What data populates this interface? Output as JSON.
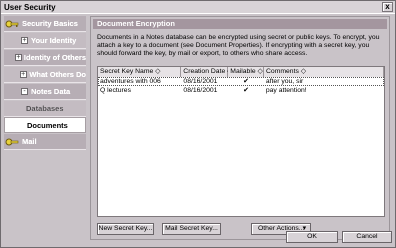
{
  "window": {
    "title": "User Security",
    "close_label": "x"
  },
  "sidebar": {
    "items": [
      {
        "label": "Security Basics",
        "icon": "security-basics-icon",
        "expander": ""
      },
      {
        "label": "Your Identity",
        "icon": "",
        "expander": "+"
      },
      {
        "label": "Identity of Others",
        "icon": "",
        "expander": "+"
      },
      {
        "label": "What Others Do",
        "icon": "",
        "expander": "+"
      },
      {
        "label": "Notes Data",
        "icon": "",
        "expander": "-"
      },
      {
        "label": "Databases"
      },
      {
        "label": "Documents"
      },
      {
        "label": "Mail",
        "icon": "mail-key-icon"
      }
    ]
  },
  "panel": {
    "header": "Document Encryption",
    "description": "Documents in a Notes database can be encrypted using secret or public keys.  To encrypt, you attach a key to a document (see Document Properties).  If encrypting with a secret key, you should forward the key, by mail or export, to others who share access.",
    "columns": [
      "Secret Key Name ◇",
      "Creation Date ◇",
      "Mailable ◇",
      "Comments ◇"
    ],
    "rows": [
      {
        "name": "adventures with 006",
        "date": "08/16/2001",
        "mailable": "✔",
        "comment": "after you, sir"
      },
      {
        "name": "Q lectures",
        "date": "08/16/2001",
        "mailable": "✔",
        "comment": "pay attention!"
      }
    ]
  },
  "buttons": {
    "new_secret_key": "New Secret Key...",
    "mail_secret_key": "Mail Secret Key...",
    "other_actions": "Other Actions...",
    "other_actions_arrow": "▾",
    "ok": "OK",
    "cancel": "Cancel"
  }
}
